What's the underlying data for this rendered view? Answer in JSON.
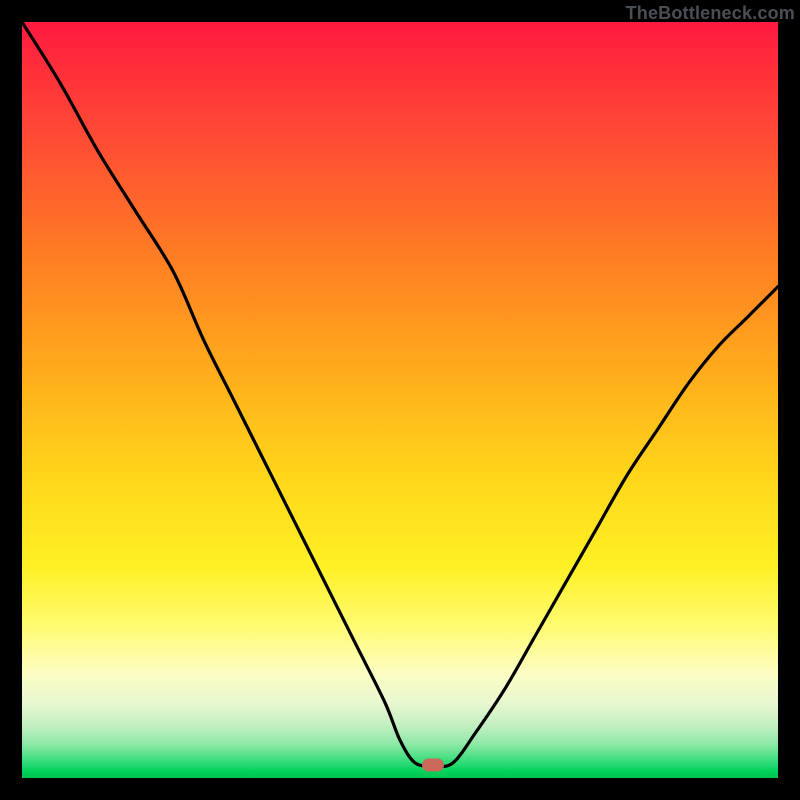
{
  "attribution": "TheBottleneck.com",
  "frame": {
    "outer_width": 800,
    "outer_height": 800,
    "border": 22,
    "border_color": "#000000"
  },
  "gradient_stops": [
    {
      "pos": 0.0,
      "color": "#ff193f"
    },
    {
      "pos": 0.15,
      "color": "#ff4a35"
    },
    {
      "pos": 0.45,
      "color": "#ffa81c"
    },
    {
      "pos": 0.72,
      "color": "#fff025"
    },
    {
      "pos": 0.9,
      "color": "#e9f7cf"
    },
    {
      "pos": 1.0,
      "color": "#00c24f"
    }
  ],
  "marker": {
    "color": "#cb6a5a",
    "x_frac": 0.544,
    "y_frac": 0.983
  },
  "chart_data": {
    "type": "line",
    "title": "",
    "xlabel": "",
    "ylabel": "",
    "xlim": [
      0,
      100
    ],
    "ylim": [
      0,
      100
    ],
    "grid": false,
    "legend": false,
    "series": [
      {
        "name": "bottleneck-curve",
        "x": [
          0,
          5,
          10,
          15,
          20,
          24,
          28,
          32,
          36,
          40,
          44,
          48,
          50,
          52,
          54.5,
          57,
          60,
          64,
          68,
          72,
          76,
          80,
          84,
          88,
          92,
          96,
          100
        ],
        "y": [
          100,
          92,
          83,
          75,
          67,
          58,
          50,
          42,
          34,
          26,
          18,
          10,
          5,
          2,
          1.6,
          2,
          6,
          12,
          19,
          26,
          33,
          40,
          46,
          52,
          57,
          61,
          65
        ]
      }
    ],
    "annotations": [
      {
        "type": "marker",
        "x": 54.5,
        "y": 1.6,
        "label": "optimal-point"
      }
    ]
  }
}
